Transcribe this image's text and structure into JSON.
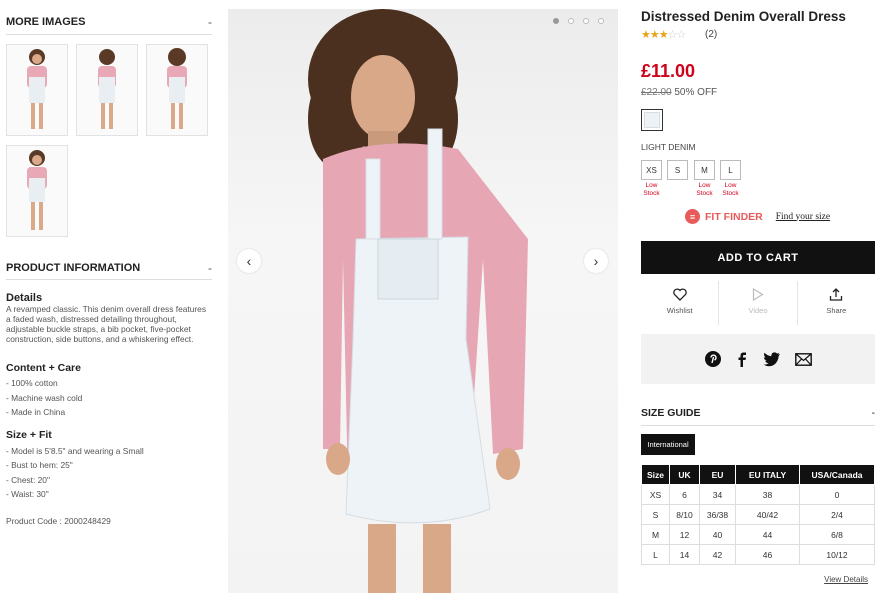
{
  "left": {
    "more_images_title": "MORE IMAGES",
    "toggle": "-",
    "product_info_title": "PRODUCT INFORMATION",
    "details_title": "Details",
    "details_text": "A revamped classic. This denim overall dress features a faded wash, distressed detailing throughout, adjustable buckle straps, a bib pocket, five-pocket construction, side buttons, and a whiskering effect.",
    "content_title": "Content + Care",
    "content_items": [
      "- 100% cotton",
      "- Machine wash cold",
      "- Made in China"
    ],
    "size_fit_title": "Size + Fit",
    "size_fit_items": [
      "- Model is 5'8.5\" and wearing a Small",
      "- Bust to hem: 25\"",
      "- Chest: 20\"",
      "- Waist: 30\""
    ],
    "product_code": "Product Code : 2000248429"
  },
  "gallery": {
    "prev_icon": "‹",
    "next_icon": "›"
  },
  "product": {
    "title": "Distressed Denim Overall Dress",
    "rating": 3,
    "rating_count": "(2)",
    "price": "£11.00",
    "old_price": "£22.00",
    "discount": "50% OFF",
    "color_name": "LIGHT DENIM",
    "sizes": [
      {
        "label": "XS",
        "stock": "Low Stock"
      },
      {
        "label": "S",
        "stock": ""
      },
      {
        "label": "M",
        "stock": "Low Stock"
      },
      {
        "label": "L",
        "stock": "Low Stock"
      }
    ],
    "fit_finder": "FIT FINDER",
    "find_size": "Find your size",
    "add_to_cart": "ADD TO CART",
    "wishlist": "Wishlist",
    "video": "Video",
    "share": "Share"
  },
  "size_guide": {
    "title": "SIZE GUIDE",
    "toggle": "-",
    "tab": "International",
    "headers": [
      "Size",
      "UK",
      "EU",
      "EU ITALY",
      "USA/Canada"
    ],
    "rows": [
      [
        "XS",
        "6",
        "34",
        "38",
        "0"
      ],
      [
        "S",
        "8/10",
        "36/38",
        "40/42",
        "2/4"
      ],
      [
        "M",
        "12",
        "40",
        "44",
        "6/8"
      ],
      [
        "L",
        "14",
        "42",
        "46",
        "10/12"
      ]
    ],
    "view_details": "View Details"
  },
  "colors": {
    "price_red": "#d0021b",
    "fit_finder_red": "#e85b5b",
    "button_black": "#111111",
    "star": "#e8a317"
  }
}
